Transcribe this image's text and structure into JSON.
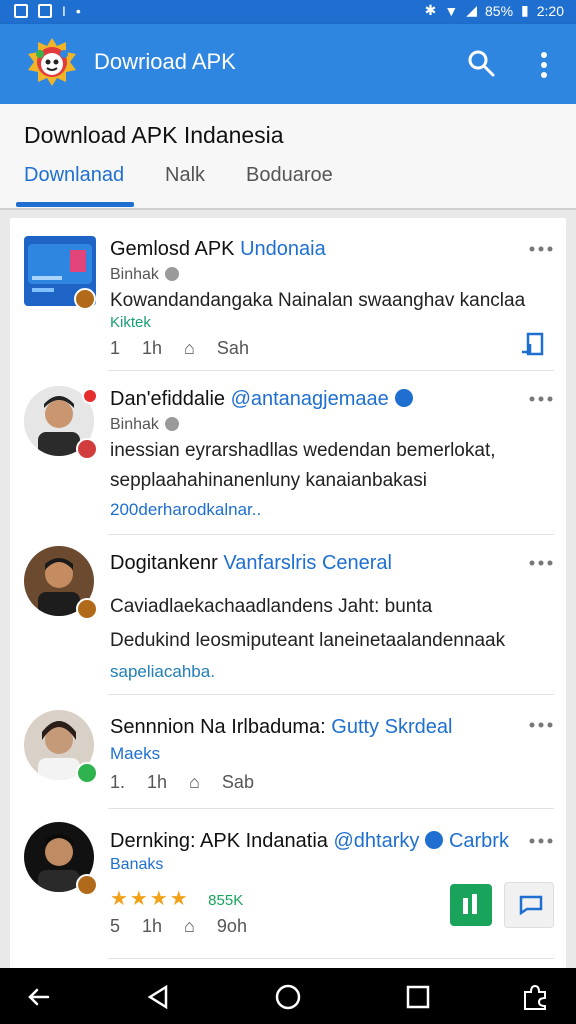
{
  "status_bar": {
    "battery": "85%",
    "time": "2:20"
  },
  "app_bar": {
    "title": "Dowrioad APK"
  },
  "header": {
    "title": "Download APK Indanesia",
    "tabs": [
      {
        "label": "Downlanad"
      },
      {
        "label": "Nalk"
      },
      {
        "label": "Boduaroe"
      }
    ]
  },
  "posts": [
    {
      "name": "Gemlosd APK",
      "handle": "Undonaia",
      "sub": "Binhak",
      "body": [
        "Kowandandangaka Nainalan swaanghav kanclaa"
      ],
      "link": "Kiktek",
      "actions": [
        "1",
        "1h",
        "Sah"
      ]
    },
    {
      "name": "Dan'efiddalie",
      "handle": "@antanagjemaae",
      "sub": "Binhak",
      "body": [
        "inessian eyrarshadllas wedendan bemerlokat,",
        "sepplaahahinanenluny kanaianbakasi"
      ],
      "link": "200derharodkalnar.."
    },
    {
      "name": "Dogitankenr",
      "handle": "Vanfarslris Ceneral",
      "body": [
        "Caviadlaekachaadlandens Jaht: bunta",
        "Dedukind leosmiputeant laneinetaalandennaak"
      ],
      "link": "sapeliacahba."
    },
    {
      "name": "Sennnion Na Irlbaduma:",
      "handle": "Gutty Skrdeal",
      "link": "Maeks",
      "actions": [
        "1.",
        "1h",
        "Sab"
      ]
    },
    {
      "name": "Dernking: APK Indanatia",
      "handle": "@dhtarky",
      "handle2": "Carbrk",
      "sub": "Banaks",
      "rating_label": "855K",
      "actions": [
        "5",
        "1h",
        "9oh"
      ]
    }
  ],
  "colors": {
    "primary": "#2f86e0",
    "accent": "#1f6fd0",
    "green": "#1aa35a",
    "star": "#f2a21a"
  }
}
